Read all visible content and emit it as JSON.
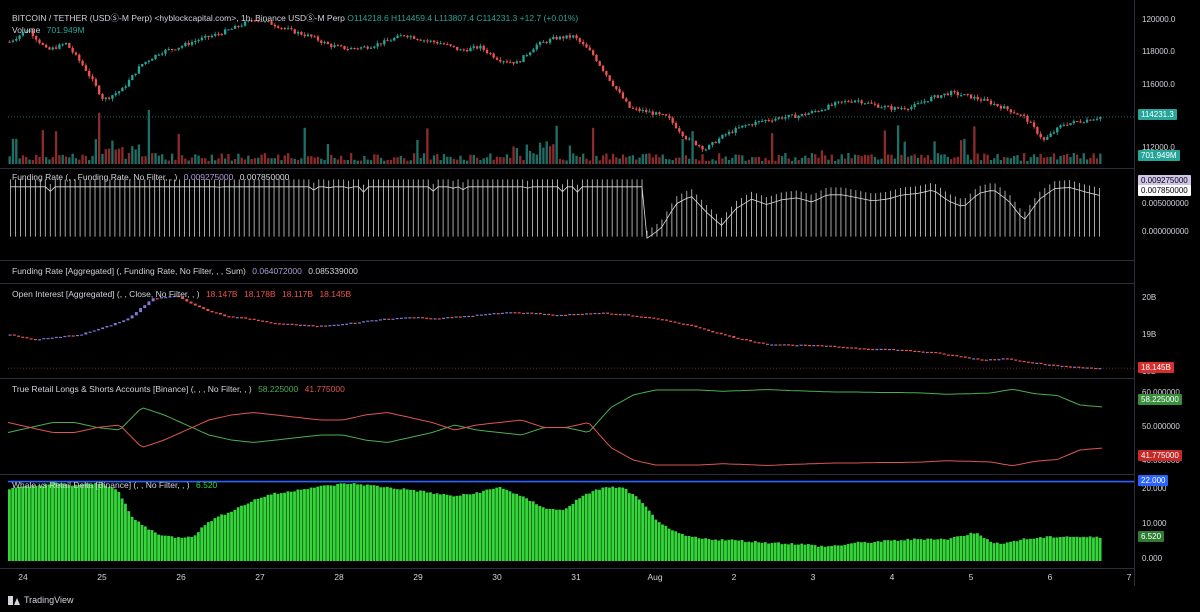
{
  "header": {
    "symbol": "BITCOIN / TETHER (USDⓈ-M Perp) <hyblockcapital.com>, 1h, Binance USDⓈ-M Perp",
    "o": "O114218.6",
    "h": "H114459.4",
    "l": "L113807.4",
    "c": "C114231.3",
    "change": "+12.7 (+0.01%)",
    "volume_label": "Volume",
    "volume_value": "701.949M"
  },
  "colors": {
    "up": "#26a69a",
    "down": "#ef5350",
    "green_line": "#4caf50",
    "red_line": "#e05555",
    "blue": "#2962ff",
    "bar_green": "#34d63a"
  },
  "panes": {
    "funding": {
      "label": "Funding Rate (, , Funding Rate, No Filter, , )",
      "v1": "0.009275000",
      "v2": "0.007850000",
      "ticks": [
        "0.005000000",
        "0.000000000"
      ],
      "tag1": "0.009275000",
      "tag2": "0.007850000"
    },
    "funding_agg": {
      "label": "Funding Rate [Aggregated] (, Funding Rate, No Filter, , , Sum)",
      "v1": "0.064072000",
      "v2": "0.085339000"
    },
    "oi": {
      "label": "Open Interest [Aggregated] (, , Close, No Filter, , )",
      "v1": "18.147B",
      "v2": "18.178B",
      "v3": "18.117B",
      "v4": "18.145B",
      "ticks": [
        "20B",
        "19B",
        "18B"
      ],
      "tag": "18.145B"
    },
    "retail": {
      "label": "True Retail Longs & Shorts Accounts [Binance] (, , , No Filter, , )",
      "v1": "58.225000",
      "v2": "41.775000",
      "ticks": [
        "60.000000",
        "50.000000",
        "40.000000"
      ],
      "tag_green": "58.225000",
      "tag_red": "41.775000"
    },
    "delta": {
      "label": "Whale vs Retail Delta [Binance] (, , No Filter, , )",
      "v1": "6.520",
      "ticks": [
        "20.000",
        "10.000",
        "0.000"
      ],
      "tag_blue": "22.000",
      "tag_green": "6.520"
    }
  },
  "price_axis": {
    "ticks": [
      "120000.0",
      "118000.0",
      "116000.0",
      "112000.0"
    ],
    "price_tag": "114231.3",
    "volume_tag": "701.949M"
  },
  "x_axis": {
    "labels": [
      "24",
      "25",
      "26",
      "27",
      "28",
      "29",
      "30",
      "31",
      "Aug",
      "2",
      "3",
      "4",
      "5",
      "6",
      "7"
    ]
  },
  "footer": {
    "brand": "TradingView"
  },
  "chart_data": [
    {
      "type": "candlestick",
      "title": "BITCOIN / TETHER (USDⓈ-M Perp), 1h",
      "x_anchor_dates": [
        "24",
        "25",
        "26",
        "27",
        "28",
        "29",
        "30",
        "31",
        "Aug",
        "2",
        "3",
        "4",
        "5",
        "6",
        "7"
      ],
      "close_path": [
        118500,
        119200,
        118000,
        118400,
        117000,
        115200,
        115800,
        117200,
        117900,
        118200,
        118600,
        118900,
        119300,
        119800,
        119500,
        119100,
        118800,
        118300,
        118100,
        118200,
        118500,
        118900,
        118600,
        118400,
        118000,
        118200,
        117500,
        117300,
        118300,
        118700,
        118800,
        117800,
        116200,
        114700,
        114500,
        114200,
        113000,
        112400,
        113200,
        113700,
        114000,
        114200,
        114300,
        114600,
        115000,
        115200,
        114900,
        114700,
        114800,
        115300,
        115600,
        115400,
        115100,
        114700,
        114200,
        112900,
        113800,
        114000,
        114231.3
      ],
      "last_price": 114231.3,
      "ylim": [
        111500,
        120300
      ]
    },
    {
      "type": "bar",
      "title": "Volume",
      "last": "701.949M"
    },
    {
      "type": "bar",
      "title": "Funding Rate",
      "values": [
        0.0093,
        0.0093,
        0.0093,
        0.0092,
        0.0093,
        0.0093,
        0.0091,
        0.0093,
        0.0093,
        0.0092,
        0.0093,
        0.0092,
        0.0093,
        0.0093,
        0.009,
        0.0093,
        0.0093,
        0.0093,
        0.0092,
        0.0093,
        0.0088,
        0.0093,
        0.0093,
        0.0093,
        0.0093,
        0.0093,
        0.0086,
        0.0093,
        0.0093,
        0.009,
        0.002,
        -0.0008,
        -0.0013,
        0.0005,
        0.0018,
        0.0032,
        0.004,
        0.0063,
        0.0072,
        0.006,
        0.004,
        0.0018,
        0.0008,
        0.0025,
        0.0065,
        0.0078,
        0.0052,
        0.003,
        0.0058,
        0.0073,
        0.0064,
        0.0072,
        0.0075,
        0.0068,
        0.008,
        0.008,
        0.0075,
        0.007,
        0.0073,
        0.008,
        0.0082,
        0.0088,
        0.007,
        0.006,
        0.0082,
        0.0088,
        0.007,
        0.0038,
        0.0072,
        0.009,
        0.0092,
        0.0085,
        0.0079
      ],
      "last": [
        0.009275,
        0.00785
      ],
      "ylim": [
        -0.0025,
        0.0105
      ]
    },
    {
      "type": "line",
      "title": "Open Interest [Aggregated]",
      "values": [
        19.08,
        18.95,
        19.02,
        19.1,
        19.3,
        19.55,
        20.1,
        20.2,
        19.85,
        19.62,
        19.55,
        19.42,
        19.37,
        19.33,
        19.38,
        19.47,
        19.55,
        19.58,
        19.55,
        19.6,
        19.66,
        19.72,
        19.7,
        19.64,
        19.67,
        19.7,
        19.65,
        19.56,
        19.45,
        19.3,
        19.1,
        18.94,
        18.82,
        18.8,
        18.78,
        18.75,
        18.7,
        18.68,
        18.64,
        18.58,
        18.48,
        18.38,
        18.42,
        18.32,
        18.22,
        18.17,
        18.145
      ],
      "ticks": [
        "20B",
        "19B",
        "18B"
      ],
      "last": 18.145,
      "ylim": [
        17.95,
        20.35
      ]
    },
    {
      "type": "line",
      "title": "True Retail Longs & Shorts Accounts [Binance]",
      "series": [
        {
          "values": [
            48,
            50,
            52,
            52,
            50,
            49,
            58,
            55,
            51,
            47,
            45,
            44,
            45,
            46,
            47,
            47,
            45,
            44,
            46,
            48,
            51,
            49,
            48,
            47,
            50,
            50,
            48,
            58,
            63,
            65,
            65,
            65,
            64.5,
            64.8,
            65.2,
            64.8,
            64.5,
            64.2,
            64.2,
            64.0,
            64.0,
            63.8,
            63.3,
            63.5,
            63.8,
            65.3,
            63.5,
            62.8,
            59,
            58.225
          ]
        },
        {
          "values": [
            52,
            50,
            48,
            48,
            50,
            51,
            42,
            45,
            49,
            53,
            55,
            56,
            55,
            54,
            53,
            53,
            55,
            56,
            54,
            52,
            49,
            51,
            52,
            53,
            50,
            50,
            52,
            42,
            37,
            35,
            35,
            35,
            35.5,
            35.2,
            34.8,
            35.2,
            35.5,
            35.8,
            35.8,
            36.0,
            36.0,
            36.2,
            36.7,
            36.5,
            36.2,
            34.7,
            36.5,
            37.2,
            41,
            41.775
          ]
        }
      ],
      "ticks": [
        "60.000000",
        "50.000000",
        "40.000000"
      ],
      "ylim": [
        33,
        67
      ]
    },
    {
      "type": "bar",
      "title": "Whale vs Retail Delta [Binance]",
      "values": [
        20,
        20.5,
        21,
        21.5,
        21,
        21.2,
        21.5,
        20,
        12,
        9,
        7,
        6.5,
        7,
        11,
        13,
        15,
        17,
        18.5,
        19,
        20,
        20.5,
        21,
        21.5,
        21.2,
        20.7,
        20.2,
        19.8,
        19.2,
        18.5,
        18,
        18.5,
        19.5,
        20.5,
        18.5,
        16.5,
        14.5,
        14,
        17,
        19.5,
        20.5,
        20.2,
        17,
        12,
        8.5,
        7,
        6.2,
        6,
        5.8,
        5.5,
        5.2,
        5,
        4.8,
        4.5,
        4,
        4.3,
        5,
        5.2,
        5.5,
        5.8,
        6,
        6.2,
        6,
        7,
        8,
        4.8,
        5.2,
        6,
        6.4,
        6.7,
        6.8,
        6.6,
        6.52
      ],
      "reference_line": 22,
      "last": 6.52,
      "ylim": [
        0,
        23
      ]
    }
  ]
}
